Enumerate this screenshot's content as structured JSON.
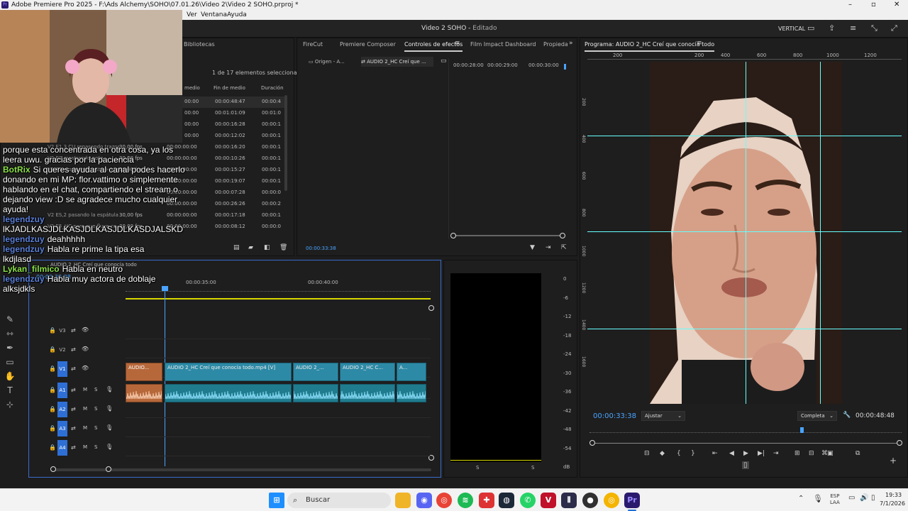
{
  "window": {
    "title": "Adobe Premiere Pro 2025 - F:\\Ads Alchemy\\SOHO\\07.01.26\\Video 2\\Video 2 SOHO.prproj *",
    "app_badge": "Pr"
  },
  "menu": {
    "items": [
      "Ver",
      "Ventana",
      "Ayuda"
    ]
  },
  "header": {
    "project_title": "Video 2 SOHO",
    "status": "Editado",
    "workspace": "VERTICAL"
  },
  "project_panel": {
    "tab": "Bibliotecas",
    "selection_info": "1 de 17 elementos seleccionados",
    "columns": [
      "medio",
      "Fin de medio",
      "Duración"
    ],
    "rows": [
      {
        "name": "",
        "fps": "",
        "start": "00:00",
        "end": "00:00:48:47",
        "dur": "00:00:4"
      },
      {
        "name": "",
        "fps": "",
        "start": "00:00",
        "end": "00:01:01:09",
        "dur": "00:01:0"
      },
      {
        "name": "",
        "fps": "",
        "start": "00:00",
        "end": "00:00:16:28",
        "dur": "00:00:1"
      },
      {
        "name": "",
        "fps": "",
        "start": "00:00",
        "end": "00:00:12:02",
        "dur": "00:00:1"
      },
      {
        "name": "V2 E1.3 CU repasando trazos",
        "fps": "30,00 fps",
        "start": "00:00:00:00",
        "end": "00:00:16:20",
        "dur": "00:00:1"
      },
      {
        "name": "V2 E2 mostrando pote",
        "fps": "30,00 fps",
        "start": "00:00:00:00",
        "end": "00:00:10:26",
        "dur": "00:00:1"
      },
      {
        "name": "V2 E3 mostrando pote + abri",
        "fps": "30,00 fps",
        "start": "00:00:00:00",
        "end": "00:00:15:27",
        "dur": "00:00:1"
      },
      {
        "name": "",
        "fps": "",
        "start": "00:00:00:00",
        "end": "00:00:19:07",
        "dur": "00:00:1"
      },
      {
        "name": "",
        "fps": "",
        "start": "00:00:00:00",
        "end": "00:00:07:28",
        "dur": "00:00:0"
      },
      {
        "name": "",
        "fps": "",
        "start": "00:00:00:00",
        "end": "00:00:26:26",
        "dur": "00:00:2"
      },
      {
        "name": "V2 ES,2 pasando la espátula",
        "fps": "30,00 fps",
        "start": "00:00:00:00",
        "end": "00:00:17:18",
        "dur": "00:00:1"
      },
      {
        "name": "V2 E5_HC pero que fluye co",
        "fps": "30,00 fps",
        "start": "00:00:00:00",
        "end": "00:00:08:12",
        "dur": "00:00:0"
      }
    ]
  },
  "effects_panel": {
    "tabs": [
      "FireCut",
      "Premiere Composer",
      "Controles de efectos",
      "Film Impact Dashboard",
      "Propiedad"
    ],
    "subtabs": [
      "Origen - A...",
      "AUDIO 2_HC Creí que ..."
    ],
    "ruler": [
      "00:00:28:00",
      "00:00:29:00",
      "00:00:30:00"
    ],
    "timecode": "00:00:33:38"
  },
  "program_monitor": {
    "tab": "Programa: AUDIO 2_HC Creí que conocía todo",
    "ruler": [
      "200",
      "200",
      "400",
      "600",
      "800",
      "1000",
      "1200"
    ],
    "vruler": [
      "200",
      "400",
      "600",
      "800",
      "1000",
      "1200",
      "1400",
      "1600"
    ],
    "timecode_current": "00:00:33:38",
    "fit": "Ajustar",
    "quality": "Completa",
    "timecode_duration": "00:00:48:48"
  },
  "timeline": {
    "sequence_tab": "AUDIO 2_HC Creí que conocía todo",
    "timecode": "00:00:33:38",
    "ruler": [
      "00:00:35:00",
      "00:00:40:00"
    ],
    "video_tracks": [
      "V3",
      "V2",
      "V1"
    ],
    "audio_tracks": [
      "A1",
      "A2",
      "A3",
      "A4"
    ],
    "track_buttons": [
      "M",
      "S"
    ],
    "clips_v1": [
      "AUDIO...",
      "AUDIO 2_HC Creí que conocía todo.mp4 [V]",
      "AUDIO 2_...",
      "AUDIO 2_HC C...",
      "A..."
    ]
  },
  "audio_meter": {
    "scale": [
      "0",
      "-6",
      "-12",
      "-18",
      "-24",
      "-30",
      "-36",
      "-42",
      "-48",
      "-54",
      "dB"
    ],
    "solo": [
      "S",
      "S"
    ]
  },
  "chat": [
    {
      "user": "",
      "text": "porque esta concentrada en otra cosa, ya los",
      "color": "#ffffff"
    },
    {
      "user": "",
      "text": "leera uwu. gracias por la paciencia",
      "color": "#ffffff"
    },
    {
      "user": "BotRix",
      "text": "Si queres ayudar al canal podes hacerlo",
      "color": "#8be04a"
    },
    {
      "user": "",
      "text": "donando en mi MP: flor.vattimo o simplemente",
      "color": "#ffffff"
    },
    {
      "user": "",
      "text": "hablando en el chat, compartiendo el stream o",
      "color": "#ffffff"
    },
    {
      "user": "",
      "text": "dejando view :D se agradece mucho cualquier",
      "color": "#ffffff"
    },
    {
      "user": "",
      "text": "ayuda!",
      "color": "#ffffff"
    },
    {
      "user": "legendzuy",
      "text": "",
      "color": "#5a7fd6"
    },
    {
      "user": "",
      "text": "lKJADLKASJDLKASJDLKASJDLKASDJALSKD",
      "color": "#ffffff"
    },
    {
      "user": "legendzuy",
      "text": "deahhhhh",
      "color": "#5a7fd6"
    },
    {
      "user": "legendzuy",
      "text": "Habla re prime la tipa esa",
      "color": "#5a7fd6"
    },
    {
      "user": "",
      "text": "lkdjlasd",
      "color": "#ffffff"
    },
    {
      "user": "Lykan_filmico",
      "text": "Habla en neutro",
      "color": "#8be04a"
    },
    {
      "user": "legendzuy",
      "text": "Habla muy actora de doblaje",
      "color": "#5a7fd6"
    },
    {
      "user": "",
      "text": "alksjdkls",
      "color": "#ffffff"
    }
  ],
  "taskbar": {
    "search": "Buscar",
    "lang": "ESP",
    "lang2": "LAA",
    "time": "19:33",
    "date": "7/1/2026"
  },
  "colors": {
    "accent": "#4aa3ff",
    "track": "#2e6fd6",
    "clip_video": "#2d8aa6",
    "clip_audio": "#1f7c8e",
    "clip_orange": "#b7683a"
  }
}
